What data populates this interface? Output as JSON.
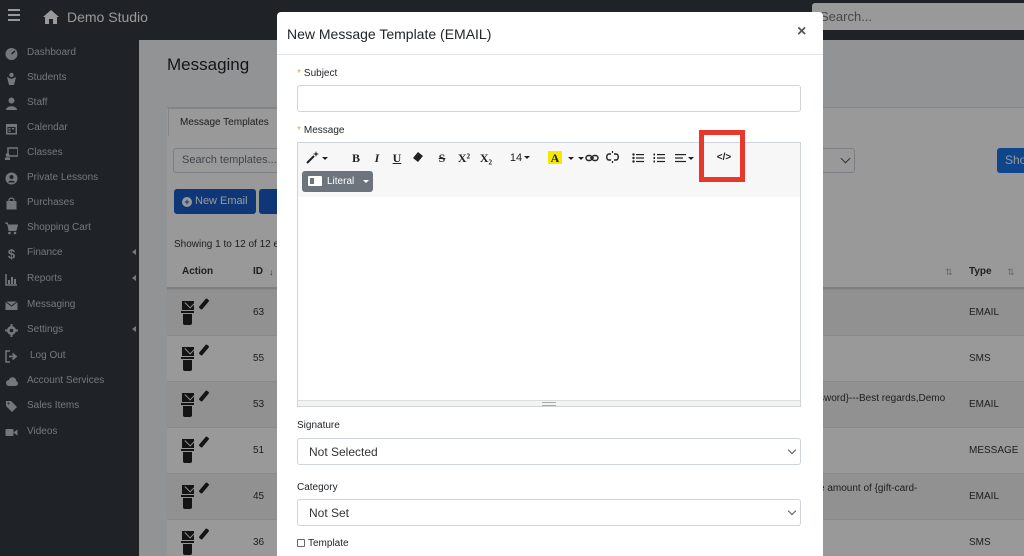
{
  "app": {
    "brand": "Demo Studio",
    "search_placeholder": "Search..."
  },
  "sidebar": {
    "items": [
      {
        "label": "Dashboard",
        "icon": "dashboard-icon"
      },
      {
        "label": "Students",
        "icon": "student-icon"
      },
      {
        "label": "Staff",
        "icon": "user-icon"
      },
      {
        "label": "Calendar",
        "icon": "calendar-icon"
      },
      {
        "label": "Classes",
        "icon": "classes-icon"
      },
      {
        "label": "Private Lessons",
        "icon": "user-circle-icon"
      },
      {
        "label": "Purchases",
        "icon": "shopping-bag-icon"
      },
      {
        "label": "Shopping Cart",
        "icon": "cart-icon"
      },
      {
        "label": "Finance",
        "icon": "dollar-icon",
        "has_submenu": true
      },
      {
        "label": "Reports",
        "icon": "chart-icon",
        "has_submenu": true
      },
      {
        "label": "Messaging",
        "icon": "envelope-icon"
      },
      {
        "label": "Settings",
        "icon": "gear-icon",
        "has_submenu": true
      },
      {
        "label": "Log Out",
        "icon": "logout-icon"
      },
      {
        "label": "Account Services",
        "icon": "cloud-icon"
      },
      {
        "label": "Sales Items",
        "icon": "tags-icon"
      },
      {
        "label": "Videos",
        "icon": "video-icon"
      }
    ]
  },
  "page": {
    "title": "Messaging",
    "tab": "Message Templates",
    "search_placeholder": "Search templates...",
    "show_button": "Sho",
    "new_email_button": "New Email",
    "showing": "Showing 1 to 12 of 12 e",
    "table": {
      "headers": {
        "action": "Action",
        "id": "ID",
        "type": "Type"
      },
      "rows": [
        {
          "id": "63",
          "text": "",
          "type": "EMAIL"
        },
        {
          "id": "55",
          "text": "",
          "type": "SMS"
        },
        {
          "id": "53",
          "text": "sword}---Best regards,Demo",
          "type": "EMAIL"
        },
        {
          "id": "51",
          "text": "",
          "type": "MESSAGE"
        },
        {
          "id": "45",
          "text": "e amount of {gift-card-",
          "type": "EMAIL"
        },
        {
          "id": "36",
          "text": "",
          "type": "SMS"
        }
      ]
    }
  },
  "modal": {
    "title": "New Message Template (EMAIL)",
    "close": "×",
    "subject_label": "Subject",
    "subject_value": "",
    "message_label": "Message",
    "toolbar": {
      "style": "style-magic-icon",
      "bold": "B",
      "italic": "I",
      "underline": "U",
      "eraser": "eraser-icon",
      "strike": "S",
      "superscript": "X²",
      "subscript": "X₂",
      "font_size": "14",
      "color_letter": "A",
      "highlight_color": "#f5e900",
      "code_view": "</>"
    },
    "literal_button": "Literal",
    "signature_label": "Signature",
    "signature_value": "Not Selected",
    "category_label": "Category",
    "category_value": "Not Set",
    "template_label": "Template",
    "highlight_color": "#e8382b"
  }
}
